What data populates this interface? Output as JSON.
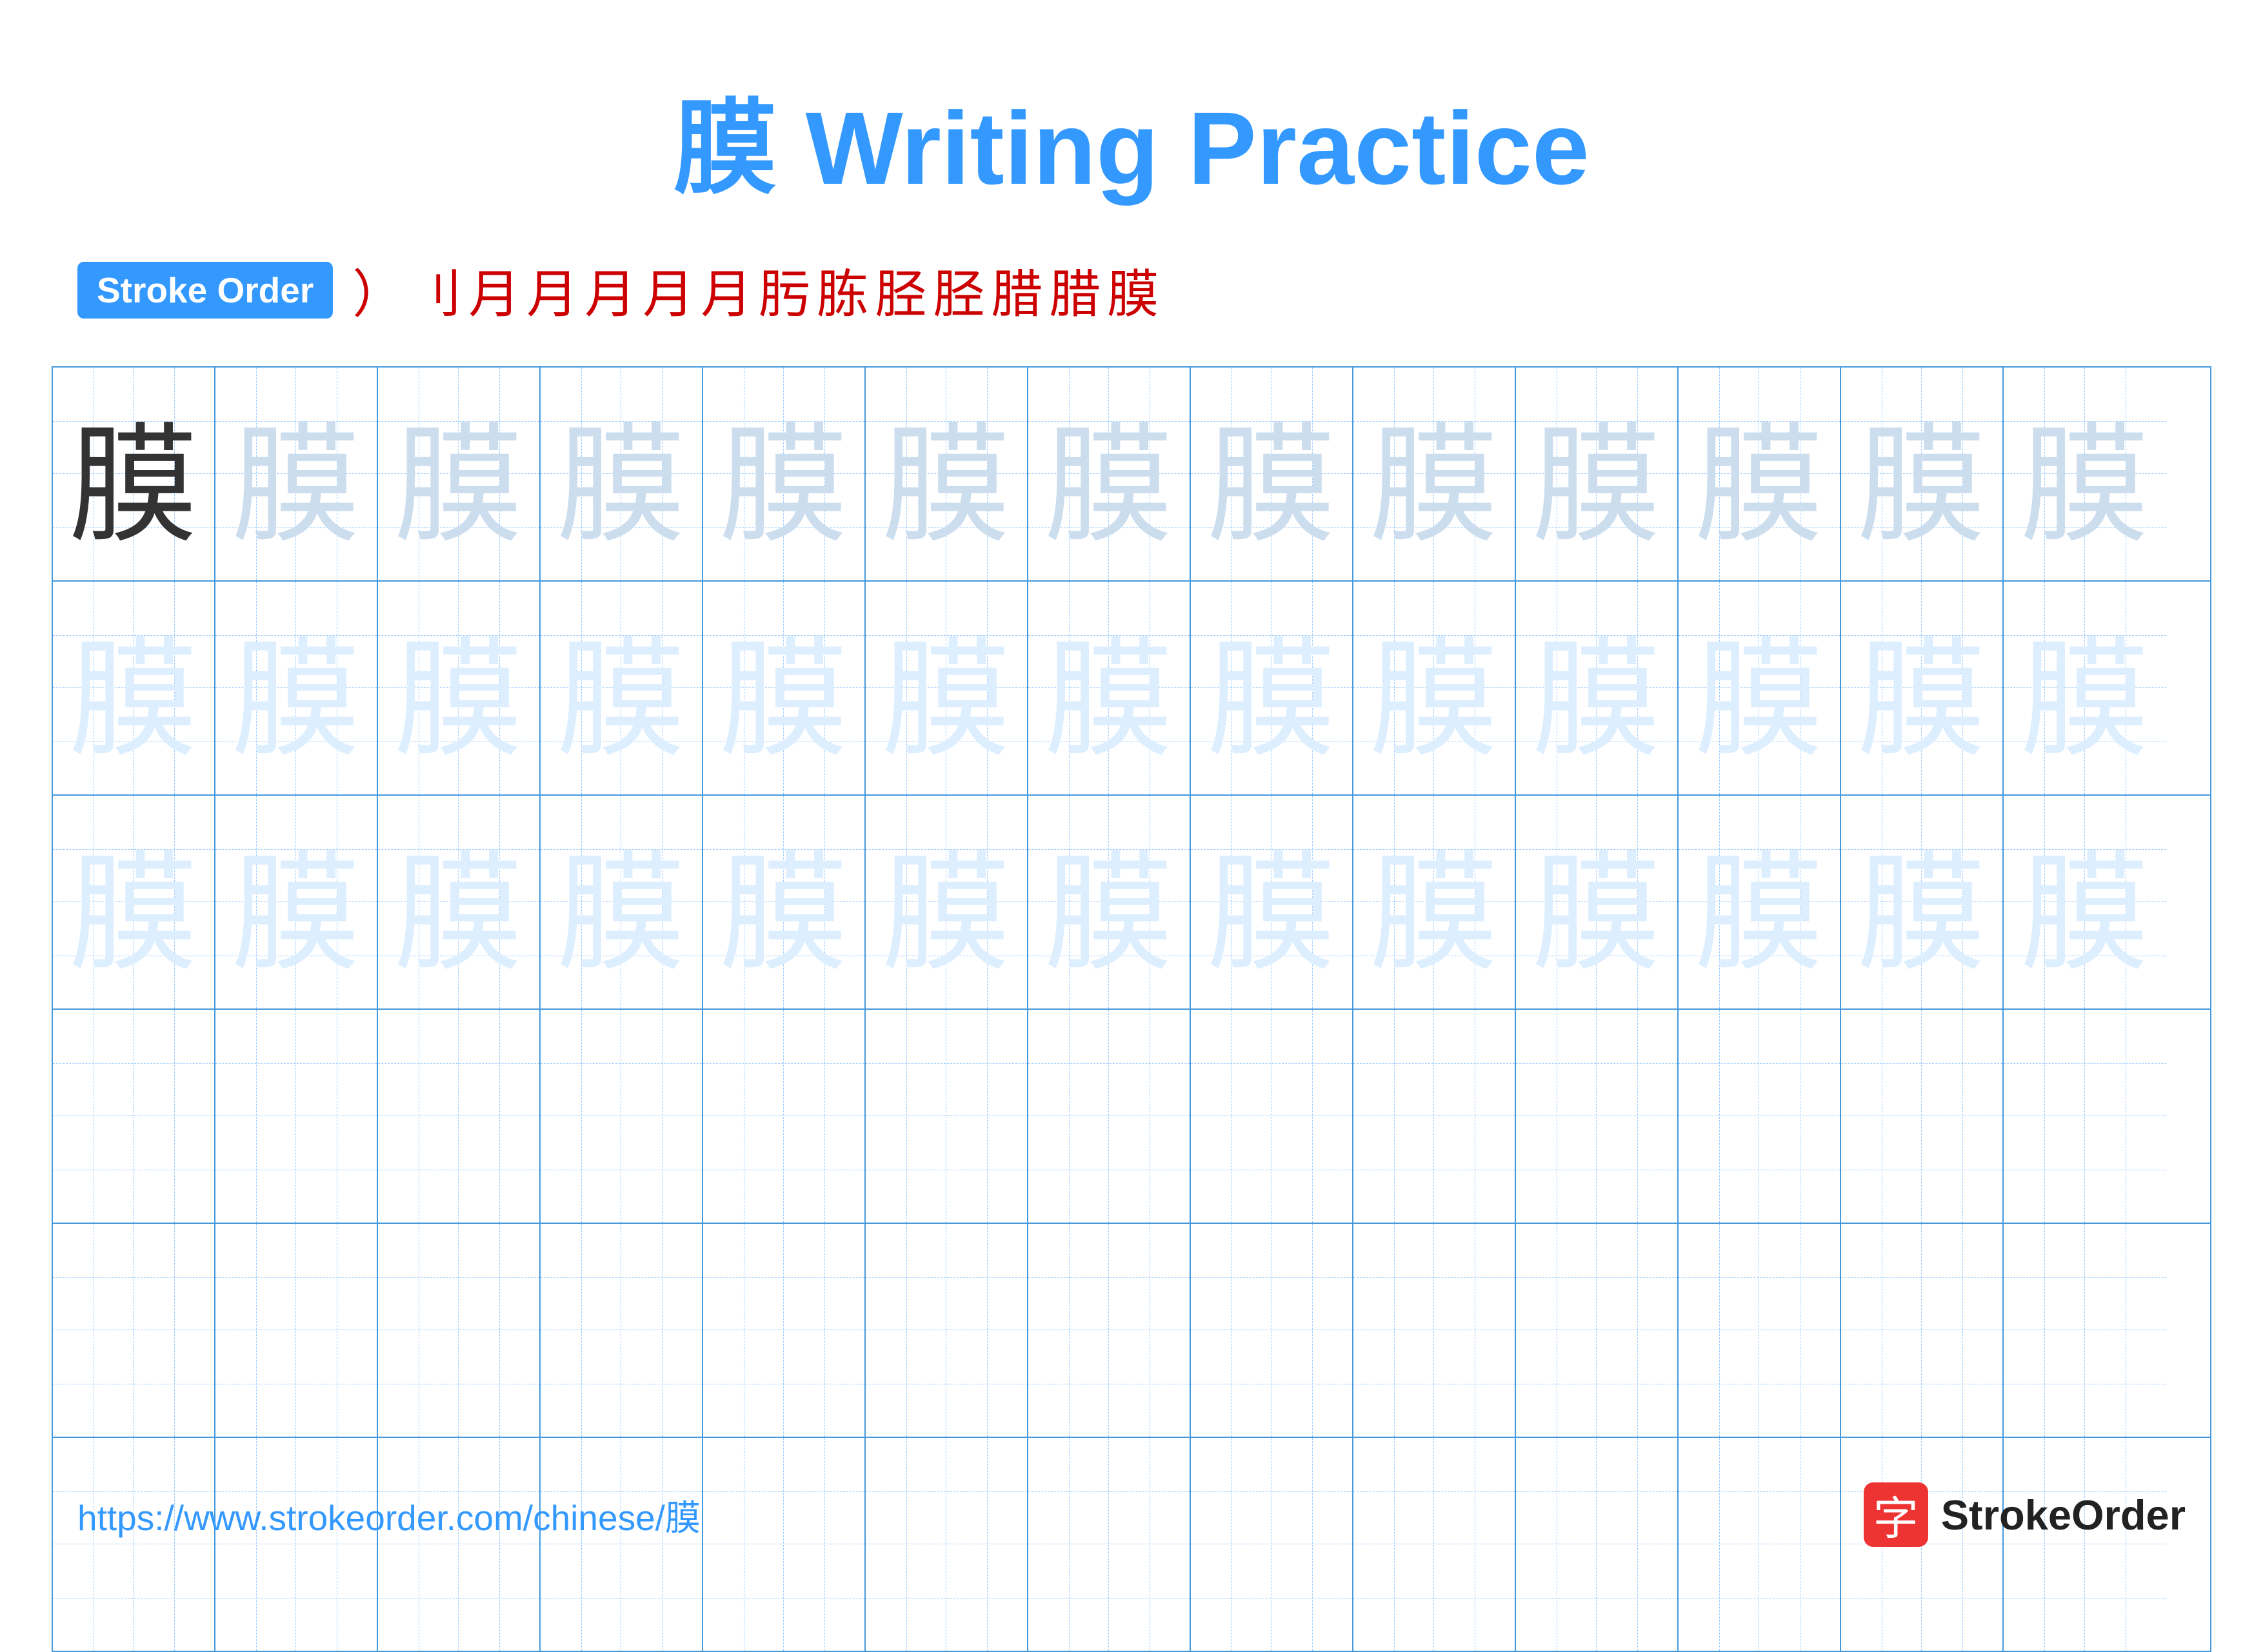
{
  "title": "膜 Writing Practice",
  "character": "膜",
  "stroke_order_label": "Stroke Order",
  "stroke_steps": [
    "⟩",
    "刂",
    "月",
    "月",
    "月",
    "月`",
    "月`",
    "肟",
    "胨",
    "胫",
    "胫",
    "腊",
    "腊",
    "膜"
  ],
  "rows": [
    {
      "cells": [
        {
          "char": "膜",
          "style": "dark"
        },
        {
          "char": "膜",
          "style": "light"
        },
        {
          "char": "膜",
          "style": "light"
        },
        {
          "char": "膜",
          "style": "light"
        },
        {
          "char": "膜",
          "style": "light"
        },
        {
          "char": "膜",
          "style": "light"
        },
        {
          "char": "膜",
          "style": "light"
        },
        {
          "char": "膜",
          "style": "light"
        },
        {
          "char": "膜",
          "style": "light"
        },
        {
          "char": "膜",
          "style": "light"
        },
        {
          "char": "膜",
          "style": "light"
        },
        {
          "char": "膜",
          "style": "light"
        },
        {
          "char": "膜",
          "style": "light"
        }
      ]
    },
    {
      "cells": [
        {
          "char": "膜",
          "style": "lighter"
        },
        {
          "char": "膜",
          "style": "lighter"
        },
        {
          "char": "膜",
          "style": "lighter"
        },
        {
          "char": "膜",
          "style": "lighter"
        },
        {
          "char": "膜",
          "style": "lighter"
        },
        {
          "char": "膜",
          "style": "lighter"
        },
        {
          "char": "膜",
          "style": "lighter"
        },
        {
          "char": "膜",
          "style": "lighter"
        },
        {
          "char": "膜",
          "style": "lighter"
        },
        {
          "char": "膜",
          "style": "lighter"
        },
        {
          "char": "膜",
          "style": "lighter"
        },
        {
          "char": "膜",
          "style": "lighter"
        },
        {
          "char": "膜",
          "style": "lighter"
        }
      ]
    },
    {
      "cells": [
        {
          "char": "膜",
          "style": "lighter"
        },
        {
          "char": "膜",
          "style": "lighter"
        },
        {
          "char": "膜",
          "style": "lighter"
        },
        {
          "char": "膜",
          "style": "lighter"
        },
        {
          "char": "膜",
          "style": "lighter"
        },
        {
          "char": "膜",
          "style": "lighter"
        },
        {
          "char": "膜",
          "style": "lighter"
        },
        {
          "char": "膜",
          "style": "lighter"
        },
        {
          "char": "膜",
          "style": "lighter"
        },
        {
          "char": "膜",
          "style": "lighter"
        },
        {
          "char": "膜",
          "style": "lighter"
        },
        {
          "char": "膜",
          "style": "lighter"
        },
        {
          "char": "膜",
          "style": "lighter"
        }
      ]
    },
    {
      "cells": [
        {
          "char": "",
          "style": "empty"
        },
        {
          "char": "",
          "style": "empty"
        },
        {
          "char": "",
          "style": "empty"
        },
        {
          "char": "",
          "style": "empty"
        },
        {
          "char": "",
          "style": "empty"
        },
        {
          "char": "",
          "style": "empty"
        },
        {
          "char": "",
          "style": "empty"
        },
        {
          "char": "",
          "style": "empty"
        },
        {
          "char": "",
          "style": "empty"
        },
        {
          "char": "",
          "style": "empty"
        },
        {
          "char": "",
          "style": "empty"
        },
        {
          "char": "",
          "style": "empty"
        },
        {
          "char": "",
          "style": "empty"
        }
      ]
    },
    {
      "cells": [
        {
          "char": "",
          "style": "empty"
        },
        {
          "char": "",
          "style": "empty"
        },
        {
          "char": "",
          "style": "empty"
        },
        {
          "char": "",
          "style": "empty"
        },
        {
          "char": "",
          "style": "empty"
        },
        {
          "char": "",
          "style": "empty"
        },
        {
          "char": "",
          "style": "empty"
        },
        {
          "char": "",
          "style": "empty"
        },
        {
          "char": "",
          "style": "empty"
        },
        {
          "char": "",
          "style": "empty"
        },
        {
          "char": "",
          "style": "empty"
        },
        {
          "char": "",
          "style": "empty"
        },
        {
          "char": "",
          "style": "empty"
        }
      ]
    },
    {
      "cells": [
        {
          "char": "",
          "style": "empty"
        },
        {
          "char": "",
          "style": "empty"
        },
        {
          "char": "",
          "style": "empty"
        },
        {
          "char": "",
          "style": "empty"
        },
        {
          "char": "",
          "style": "empty"
        },
        {
          "char": "",
          "style": "empty"
        },
        {
          "char": "",
          "style": "empty"
        },
        {
          "char": "",
          "style": "empty"
        },
        {
          "char": "",
          "style": "empty"
        },
        {
          "char": "",
          "style": "empty"
        },
        {
          "char": "",
          "style": "empty"
        },
        {
          "char": "",
          "style": "empty"
        },
        {
          "char": "",
          "style": "empty"
        }
      ]
    }
  ],
  "footer": {
    "url": "https://www.strokeorder.com/chinese/膜",
    "logo_char": "字",
    "logo_text": "StrokeOrder"
  }
}
